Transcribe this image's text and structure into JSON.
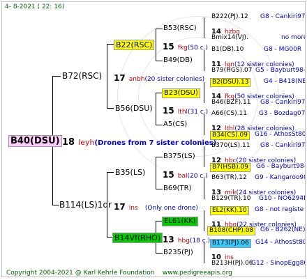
{
  "header": {
    "date": "4- 8-2021 ( 22: 16)"
  },
  "footer": {
    "copyright": "Copyright 2004-2021 @ Karl Kehrle Foundation",
    "site": "www.pedigreeapis.org"
  },
  "colors": {
    "yellow": "#ffff00",
    "green": "#00cc00",
    "cyan": "#33ccff",
    "root_bg": "#ffccff",
    "connector": "#000000",
    "text_blue": "#0000cc",
    "text_red": "#cc0000",
    "text_magenta": "#cc00cc",
    "footer_green": "#006600"
  },
  "root": {
    "label": "B40(DSU)",
    "num": "18",
    "mid": "leyh",
    "note": "(Drones from 7 sister colonies)"
  },
  "g1": {
    "top": {
      "label": "B72(RSC)",
      "num": "17",
      "mid": "anbh",
      "note": "(20 sister colonies)"
    },
    "bottom": {
      "label": "B114(LS)1dr",
      "num": "17",
      "mid": "ins",
      "note": "(Only one drone)"
    }
  },
  "g2": {
    "a": {
      "label": "B22(RSC)",
      "num": "15",
      "mid": "fkg",
      "note": "(50 c.)"
    },
    "b": {
      "label": "B56(DSU)",
      "num": "15",
      "mid": "lthl",
      "note": "(31 c.)"
    },
    "c": {
      "label": "B35(LS)",
      "num": "15",
      "mid": "bal",
      "note": "(20 c.)"
    },
    "d": {
      "label": "B14Vf(RHO)",
      "num": "13",
      "mid": "hbg",
      "note": "(18 c.)"
    }
  },
  "g3": {
    "a1": {
      "label": "B53(RSC)"
    },
    "a2": {
      "label": "B49(DB)"
    },
    "b1": {
      "label": "B23(DSU)"
    },
    "b2": {
      "label": "A5(CS)"
    },
    "c1": {
      "label": "B375(LS)"
    },
    "c2": {
      "label": "B69(TR)"
    },
    "d1": {
      "label": "EL61(KK)"
    },
    "d2": {
      "label": "B235(PJ)"
    }
  },
  "g4": [
    {
      "label": "B222(PJ).12",
      "code": "G8 - Cankiri97Q"
    },
    {
      "num": "14",
      "mid": "hzbg"
    },
    {
      "label": "Bmix14(VJ).",
      "code": "no more"
    },
    {
      "label": "B1(DB).10",
      "code": "G8 - MG00R"
    },
    {
      "num": "11",
      "mid": "lgn",
      "note": "(12 sister colonies)"
    },
    {
      "label": "B79(HGS).07",
      "code": "G5 - Bayburt98-3"
    },
    {
      "label": "B2(DSU).13",
      "code": "G4 - B418(NE)"
    },
    {
      "num": "14",
      "mid": "fkg",
      "note": "(50 sister colonies)"
    },
    {
      "label": "B46(BZF).11",
      "code": "G8 - Cankiri97Q"
    },
    {
      "label": "A66(CS).11",
      "code": "G3 - Bozdag07R"
    },
    {
      "num": "12",
      "mid": "lthl",
      "note": "(28 sister colonies)"
    },
    {
      "label": "B34(CS).09",
      "code": "G16 - AthosSt80R"
    },
    {
      "label": "B370(LS).11",
      "code": "G8 - Cankiri97Q"
    },
    {
      "num": "12",
      "mid": "hbc",
      "note": "(20 sister colonies)"
    },
    {
      "label": "B7(HSB).09",
      "code": "G6 - Bayburt98-3"
    },
    {
      "label": "B63(TR).12",
      "code": "G9 - Kangaroo98R"
    },
    {
      "num": "13",
      "mik": "",
      "mid": "mik",
      "note": "(24 sister colonies)"
    },
    {
      "label": "B129(TR).10",
      "code": "G10 - NO6294R"
    },
    {
      "label": "EL2(KK).10",
      "code": "G8 - not registe"
    },
    {
      "num": "11",
      "mid": "hbg",
      "note": "(22 sister colonies)"
    },
    {
      "label": "B108(CHP).08",
      "code": "G6 - B262(NE)"
    },
    {
      "label": "B173(PJ).06",
      "code": "G14 - AthosSt80R"
    },
    {
      "num": "10",
      "mid": "ins"
    },
    {
      "label": "B213H(PJ).06",
      "code": "G12 - SinopEgg86R"
    }
  ]
}
